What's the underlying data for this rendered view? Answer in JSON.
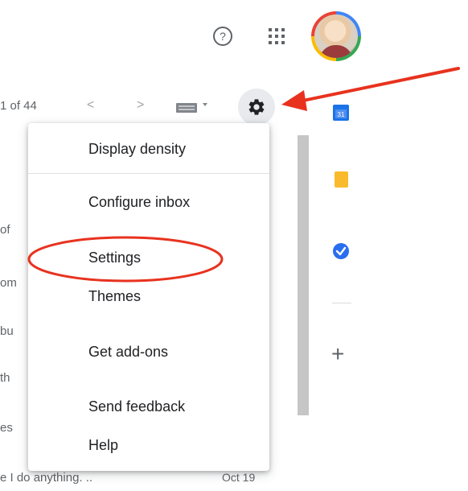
{
  "header": {
    "help_icon": "help-circle-icon",
    "apps_icon": "apps-grid-icon",
    "avatar": "account-avatar"
  },
  "toolbar": {
    "page_count": "1 of 44",
    "prev_label": "<",
    "next_label": ">",
    "keyboard_icon": "keyboard-icon",
    "settings_icon": "gear-icon"
  },
  "background_list": {
    "snippets": [
      "of",
      "om",
      "bu",
      "th",
      "es"
    ],
    "last_row": {
      "text": "e I do anything. ..",
      "date": "Oct 19"
    }
  },
  "settings_menu": {
    "items": [
      "Display density",
      "Configure inbox",
      "Settings",
      "Themes",
      "Get add-ons",
      "Send feedback",
      "Help"
    ]
  },
  "side_panel": {
    "calendar_label": "31",
    "icons": [
      "calendar-icon",
      "keep-icon",
      "tasks-icon",
      "add-icon"
    ],
    "add_label": "+"
  },
  "annotations": {
    "color": "#e8321e",
    "highlighted_item": "Settings",
    "arrow_target": "gear-icon"
  }
}
